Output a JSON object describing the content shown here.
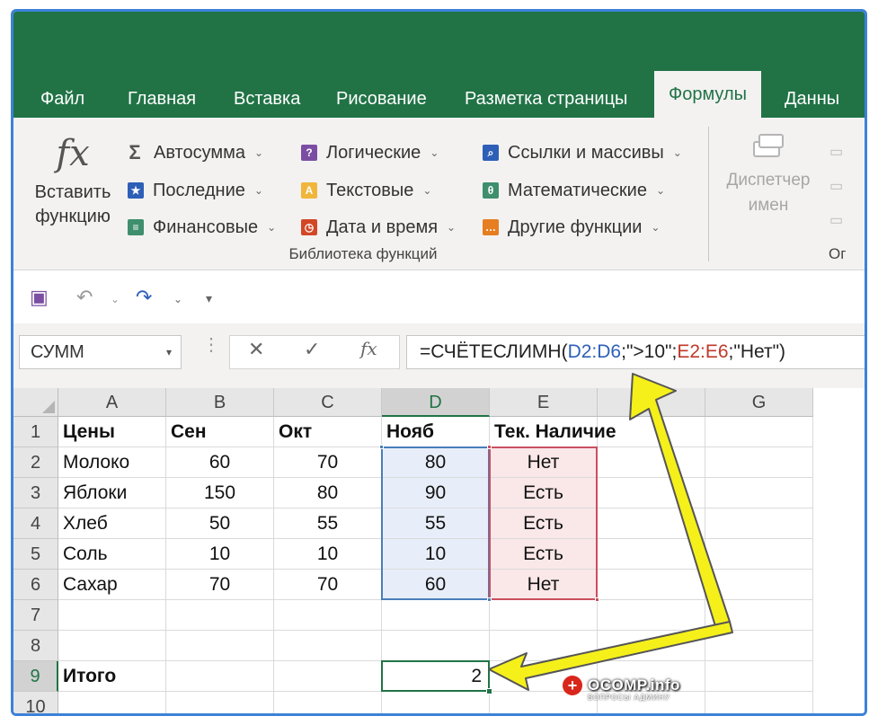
{
  "tabs": [
    {
      "label": "Файл",
      "active": false
    },
    {
      "label": "Главная",
      "active": false
    },
    {
      "label": "Вставка",
      "active": false
    },
    {
      "label": "Рисование",
      "active": false
    },
    {
      "label": "Разметка страницы",
      "active": false
    },
    {
      "label": "Формулы",
      "active": true
    },
    {
      "label": "Данны",
      "active": false
    }
  ],
  "ribbon": {
    "insert_function_line1": "Вставить",
    "insert_function_line2": "функцию",
    "insert_function_icon": "fx",
    "items": [
      {
        "label": "Автосумма",
        "icon": "sigma-icon"
      },
      {
        "label": "Последние",
        "icon": "star-icon"
      },
      {
        "label": "Финансовые",
        "icon": "book-icon"
      },
      {
        "label": "Логические",
        "icon": "question-book-icon"
      },
      {
        "label": "Текстовые",
        "icon": "text-book-icon"
      },
      {
        "label": "Дата и время",
        "icon": "clock-book-icon"
      },
      {
        "label": "Ссылки и массивы",
        "icon": "search-book-icon"
      },
      {
        "label": "Математические",
        "icon": "theta-book-icon"
      },
      {
        "label": "Другие функции",
        "icon": "more-book-icon"
      }
    ],
    "group_label": "Библиотека функций",
    "name_manager_line1": "Диспетчер",
    "name_manager_line2": "имен",
    "cut_label": "Ог"
  },
  "formula_bar": {
    "name_box": "СУММ",
    "cancel": "✕",
    "enter": "✓",
    "fx": "fx",
    "f_prefix": "=СЧЁТЕСЛИМН(",
    "f_ref1": "D2:D6",
    "f_mid": ";\">10\";",
    "f_ref2": "E2:E6",
    "f_suffix": ";\"Нет\")"
  },
  "columns": [
    "A",
    "B",
    "C",
    "D",
    "E",
    "F",
    "G"
  ],
  "rows": [
    {
      "num": "1",
      "cells": [
        "Цены",
        "Сен",
        "Окт",
        "Нояб",
        "Тек. Наличие",
        "",
        ""
      ]
    },
    {
      "num": "2",
      "cells": [
        "Молоко",
        "60",
        "70",
        "80",
        "Нет",
        "",
        ""
      ]
    },
    {
      "num": "3",
      "cells": [
        "Яблоки",
        "150",
        "80",
        "90",
        "Есть",
        "",
        ""
      ]
    },
    {
      "num": "4",
      "cells": [
        "Хлеб",
        "50",
        "55",
        "55",
        "Есть",
        "",
        ""
      ]
    },
    {
      "num": "5",
      "cells": [
        "Соль",
        "10",
        "10",
        "10",
        "Есть",
        "",
        ""
      ]
    },
    {
      "num": "6",
      "cells": [
        "Сахар",
        "70",
        "70",
        "60",
        "Нет",
        "",
        ""
      ]
    },
    {
      "num": "7",
      "cells": [
        "",
        "",
        "",
        "",
        "",
        "",
        ""
      ]
    },
    {
      "num": "8",
      "cells": [
        "",
        "",
        "",
        "",
        "",
        "",
        ""
      ]
    },
    {
      "num": "9",
      "cells": [
        "Итого",
        "",
        "",
        "2",
        "",
        "",
        ""
      ]
    },
    {
      "num": "10",
      "cells": [
        "",
        "",
        "",
        "",
        "",
        "",
        ""
      ]
    }
  ],
  "watermark": {
    "title": "OCOMP.info",
    "subtitle": "ВОПРОСЫ АДМИНУ"
  },
  "colors": {
    "excel_green": "#217346",
    "ribbon_bg": "#f3f2f1",
    "range_blue": "#4a7ebb",
    "range_red": "#c9505f",
    "arrow_yellow": "#f5f01a"
  }
}
